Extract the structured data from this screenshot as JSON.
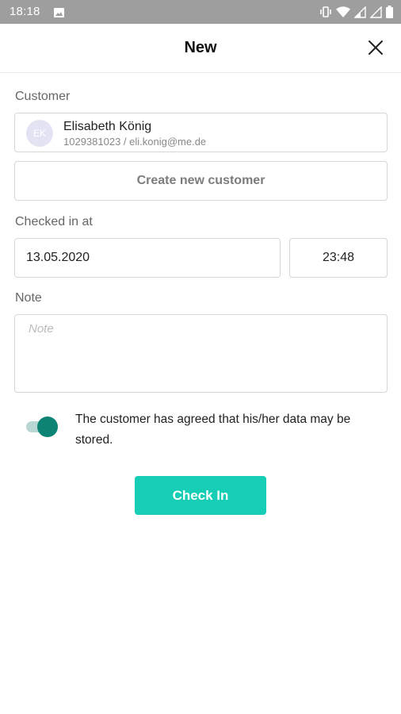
{
  "status_bar": {
    "time": "18:18",
    "icons": [
      "image-icon",
      "vibrate-icon",
      "wifi-icon",
      "signal-icon",
      "signal-empty-icon",
      "battery-icon"
    ]
  },
  "header": {
    "title": "New",
    "close_icon": "close-icon"
  },
  "customer": {
    "label": "Customer",
    "initials": "EK",
    "name": "Elisabeth König",
    "meta": "1029381023 / eli.konig@me.de",
    "create_label": "Create new customer"
  },
  "checked_in": {
    "label": "Checked in at",
    "date": "13.05.2020",
    "time": "23:48"
  },
  "note": {
    "label": "Note",
    "placeholder": "Note",
    "value": ""
  },
  "consent": {
    "enabled": true,
    "text": "The customer has agreed that his/her data may be stored."
  },
  "submit": {
    "label": "Check In"
  },
  "colors": {
    "status_bar": "#9e9e9e",
    "accent": "#16cdb5",
    "toggle_on": "#0c8374",
    "toggle_track": "#b8d6d2",
    "avatar_bg": "#e4e3f3",
    "border": "#d6d6d6"
  }
}
